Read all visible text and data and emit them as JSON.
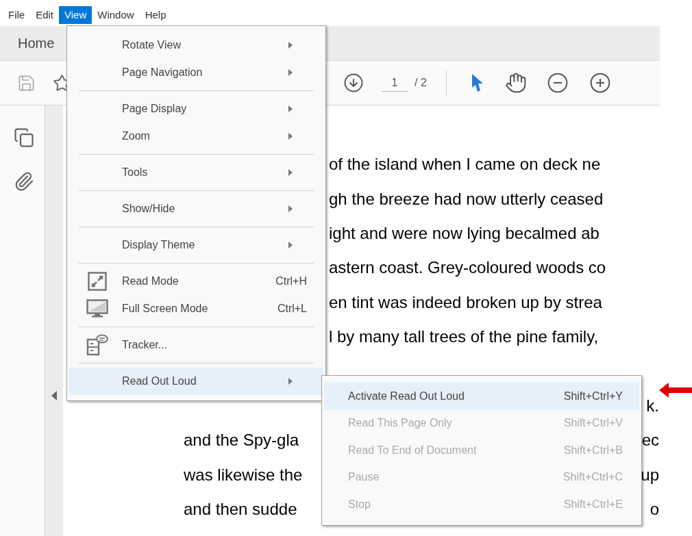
{
  "menu_bar": [
    {
      "label": "File",
      "selected": false
    },
    {
      "label": "Edit",
      "selected": false
    },
    {
      "label": "View",
      "selected": true
    },
    {
      "label": "Window",
      "selected": false
    },
    {
      "label": "Help",
      "selected": false
    }
  ],
  "tab_bar": {
    "label": "Home"
  },
  "toolbar": {
    "page_number": "1",
    "page_total": "/ 2"
  },
  "document": {
    "upper_lines": [
      "of the island when I came on deck ne",
      "gh the breeze had now utterly ceased",
      "ight and were now lying becalmed ab",
      "astern coast. Grey-coloured woods co",
      "en tint was indeed broken up by strea",
      "l by many tall trees of the pine family,"
    ],
    "lower_lines": [
      {
        "right": "k."
      },
      {
        "left": "and the Spy-gla",
        "right": "ec"
      },
      {
        "left": "was likewise the",
        "right": "up"
      },
      {
        "left": "and then sudde",
        "right": "o"
      }
    ]
  },
  "view_menu": {
    "items": [
      {
        "kind": "submenu",
        "label": "Rotate View",
        "selected": false
      },
      {
        "kind": "submenu",
        "label": "Page Navigation",
        "selected": false
      },
      {
        "kind": "separator"
      },
      {
        "kind": "submenu",
        "label": "Page Display",
        "selected": false
      },
      {
        "kind": "submenu",
        "label": "Zoom",
        "selected": false
      },
      {
        "kind": "separator"
      },
      {
        "kind": "submenu",
        "label": "Tools",
        "selected": false
      },
      {
        "kind": "separator"
      },
      {
        "kind": "submenu",
        "label": "Show/Hide",
        "selected": false
      },
      {
        "kind": "separator"
      },
      {
        "kind": "submenu",
        "label": "Display Theme",
        "selected": false
      },
      {
        "kind": "separator"
      },
      {
        "kind": "icon_command",
        "label": "Read Mode",
        "shortcut": "Ctrl+H",
        "selected": false
      },
      {
        "kind": "icon_command",
        "label": "Full Screen Mode",
        "shortcut": "Ctrl+L",
        "selected": false
      },
      {
        "kind": "separator"
      },
      {
        "kind": "icon_command",
        "label": "Tracker...",
        "selected": false
      },
      {
        "kind": "separator"
      },
      {
        "kind": "submenu",
        "label": "Read Out Loud",
        "selected": true
      }
    ]
  },
  "read_out_loud_menu": {
    "items": [
      {
        "label": "Activate Read Out Loud",
        "shortcut": "Shift+Ctrl+Y",
        "selected": true,
        "disabled": false
      },
      {
        "label": "Read This Page Only",
        "shortcut": "Shift+Ctrl+V",
        "selected": false,
        "disabled": true
      },
      {
        "label": "Read To End of Document",
        "shortcut": "Shift+Ctrl+B",
        "selected": false,
        "disabled": true
      },
      {
        "label": "Pause",
        "shortcut": "Shift+Ctrl+C",
        "selected": false,
        "disabled": true
      },
      {
        "label": "Stop",
        "shortcut": "Shift+Ctrl+E",
        "selected": false,
        "disabled": true
      }
    ]
  }
}
